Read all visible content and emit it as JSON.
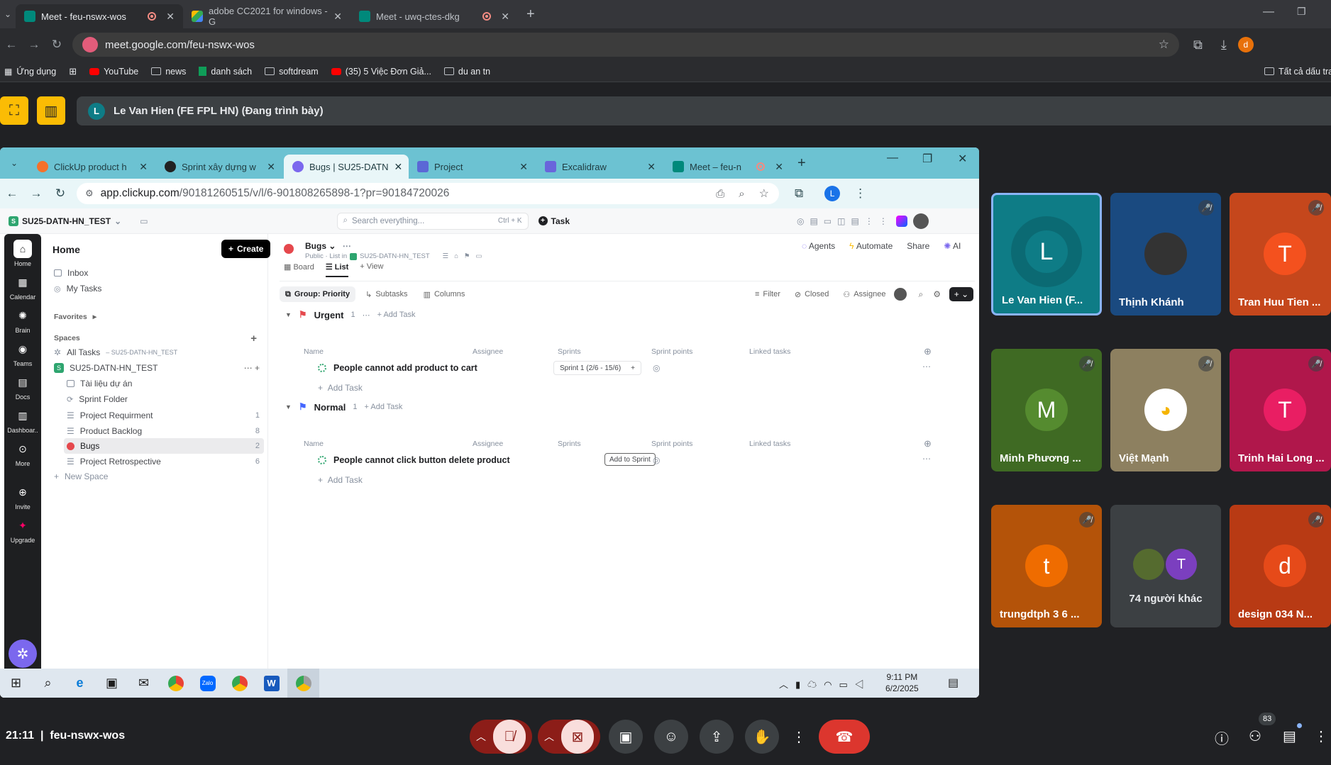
{
  "outer_browser": {
    "tabs": [
      {
        "title": "Meet - feu-nswx-wos"
      },
      {
        "title": "adobe CC2021 for windows - G"
      },
      {
        "title": "Meet - uwq-ctes-dkg"
      }
    ],
    "url": "meet.google.com/feu-nswx-wos",
    "bookmarks": [
      "Ứng dụng",
      "YouTube",
      "news",
      "danh sách",
      "softdream",
      "(35) 5 Việc Đơn Giả...",
      "du an tn"
    ],
    "bookmarks_right": "Tất cả dấu tra",
    "profile_initial": "d"
  },
  "meet": {
    "presenter_banner": "Le Van Hien (FE FPL HN) (Đang trình bày)",
    "presenter_initial": "L",
    "time": "21:11",
    "meeting_code": "feu-nswx-wos",
    "participants_count": "83",
    "tiles": [
      {
        "name": "Le Van Hien (F...",
        "initial": "L",
        "color": "#0e7c86"
      },
      {
        "name": "Thịnh Khánh",
        "initial": "",
        "color": "#1a4a80"
      },
      {
        "name": "Tran Huu Tien ...",
        "initial": "T",
        "color": "#f4511e"
      },
      {
        "name": "Minh Phương ...",
        "initial": "M",
        "color": "#558b2f"
      },
      {
        "name": "Việt Mạnh",
        "initial": "",
        "color": "#8d8060"
      },
      {
        "name": "Trinh Hai Long ...",
        "initial": "T",
        "color": "#e91e63"
      },
      {
        "name": "trungdtph 3 6 ...",
        "initial": "t",
        "color": "#ef6c00"
      },
      {
        "name": "74 người khác",
        "initial": "T",
        "color": "#3c4043"
      },
      {
        "name": "design 034 N...",
        "initial": "d",
        "color": "#e64a19"
      }
    ]
  },
  "inner_browser": {
    "tabs": [
      {
        "title": "ClickUp product h"
      },
      {
        "title": "Sprint xây dựng w"
      },
      {
        "title": "Bugs | SU25-DATN"
      },
      {
        "title": "Project"
      },
      {
        "title": "Excalidraw"
      },
      {
        "title": "Meet – feu-n"
      }
    ],
    "url_host": "app.clickup.com",
    "url_path": "/90181260515/v/l/6-901808265898-1?pr=90184720026",
    "profile_initial": "L"
  },
  "clickup": {
    "workspace": "SU25-DATN-HN_TEST",
    "search_placeholder": "Search everything...",
    "search_shortcut": "Ctrl + K",
    "task_button": "Task",
    "rail": [
      "Home",
      "Calendar",
      "Brain",
      "Teams",
      "Docs",
      "Dashboar..",
      "More",
      "Invite",
      "Upgrade"
    ],
    "sidebar": {
      "title": "Home",
      "create": "Create",
      "inbox": "Inbox",
      "my_tasks": "My Tasks",
      "favorites": "Favorites",
      "spaces": "Spaces",
      "all_tasks": "All Tasks",
      "all_tasks_sub": "SU25-DATN-HN_TEST",
      "space_name": "SU25-DATN-HN_TEST",
      "items": [
        {
          "label": "Tài liệu dự án",
          "count": ""
        },
        {
          "label": "Sprint Folder",
          "count": ""
        },
        {
          "label": "Project Requirment",
          "count": "1"
        },
        {
          "label": "Product Backlog",
          "count": "8"
        },
        {
          "label": "Bugs",
          "count": "2"
        },
        {
          "label": "Project Retrospective",
          "count": "6"
        }
      ],
      "new_space": "New Space"
    },
    "list": {
      "name": "Bugs",
      "meta": "Public · List in",
      "meta_space": "SU25-DATN-HN_TEST",
      "agents": "Agents",
      "automate": "Automate",
      "share": "Share",
      "ai": "AI",
      "views": [
        "Board",
        "List",
        "View"
      ],
      "toolbar": [
        "Group: Priority",
        "Subtasks",
        "Columns"
      ],
      "toolbar_right": [
        "Filter",
        "Closed",
        "Assignee"
      ],
      "columns": [
        "Name",
        "Assignee",
        "Sprints",
        "Sprint points",
        "Linked tasks"
      ],
      "groups": [
        {
          "name": "Urgent",
          "count": "1",
          "add": "Add Task",
          "color": "#e5484d",
          "task": "People cannot add product to cart",
          "sprint": "Sprint 1 (2/6 - 15/6)"
        },
        {
          "name": "Normal",
          "count": "1",
          "add": "Add Task",
          "color": "#4466ff",
          "task": "People cannot click button delete product",
          "sprint": "Add to Sprint"
        }
      ],
      "add_task": "Add Task"
    }
  },
  "taskbar": {
    "time": "9:11 PM",
    "date": "6/2/2025"
  }
}
